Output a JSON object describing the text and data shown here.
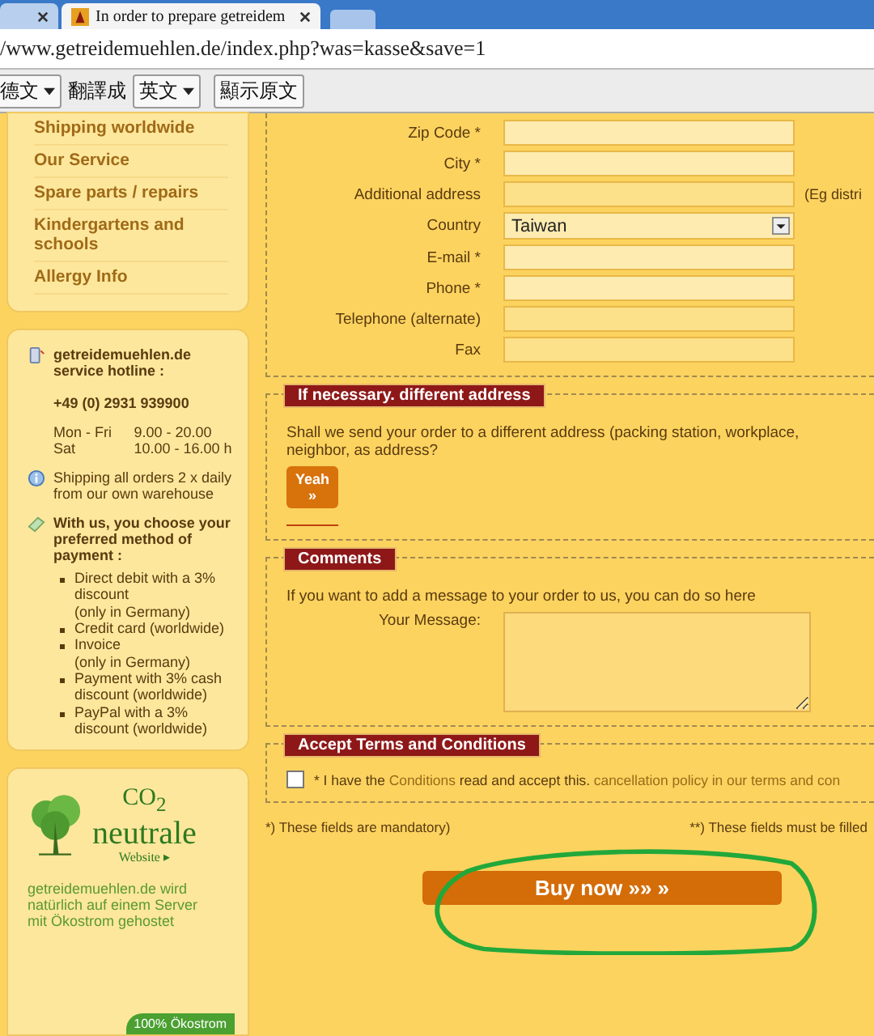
{
  "browser": {
    "tabs": [
      {
        "selected": false
      },
      {
        "title": "In order to prepare getreidem",
        "selected": true
      }
    ],
    "address": "/www.getreidemuehlen.de/index.php?was=kasse&save=1"
  },
  "translate_bar": {
    "from_language": "德文",
    "label": "翻譯成",
    "to_language": "英文",
    "show_original": "顯示原文"
  },
  "sidebar": {
    "nav_items": [
      "Shipping worldwide",
      "Our Service",
      "Spare parts / repairs",
      "Kindergartens and schools",
      "Allergy Info"
    ],
    "hotline": {
      "title": "getreidemuehlen.de service hotline :",
      "phone": "+49 (0) 2931 939900",
      "hours": [
        {
          "days": "Mon - Fri",
          "time": "9.00 - 20.00"
        },
        {
          "days": "Sat",
          "time": "10.00 - 16.00 h"
        }
      ]
    },
    "shipping_note": "Shipping all orders 2 x daily from our own warehouse",
    "payment": {
      "title": "With us, you choose your preferred method of payment :",
      "methods": [
        "Direct debit with a 3% discount\n(only in Germany)",
        "Credit card (worldwide)",
        "Invoice\n(only in Germany)",
        "Payment with 3% cash discount (worldwide)",
        "PayPal with a 3% discount (worldwide)"
      ]
    },
    "eco": {
      "logo_top": "CO$_{2}$",
      "logo_main": "neutrale",
      "logo_link": "Website ▸",
      "text": "getreidemuehlen.de wird natürlich auf einem Server mit Ökostrom gehostet",
      "badge": "100% Ökostrom"
    }
  },
  "address_form": {
    "fields": [
      {
        "label": "Zip Code *",
        "kind": "text"
      },
      {
        "label": "City *",
        "kind": "text"
      },
      {
        "label": "Additional address",
        "kind": "text",
        "hint": "(Eg distri"
      },
      {
        "label": "Country",
        "kind": "select",
        "value": "Taiwan"
      },
      {
        "label": "E-mail *",
        "kind": "text"
      },
      {
        "label": "Phone *",
        "kind": "text"
      },
      {
        "label": "Telephone (alternate)",
        "kind": "text"
      },
      {
        "label": "Fax",
        "kind": "text"
      }
    ]
  },
  "different_address": {
    "legend": "If necessary. different address",
    "question": "Shall we send your order to a different address (packing station, workplace, neighbor, as address?",
    "button": "Yeah\n»"
  },
  "comments": {
    "legend": "Comments",
    "intro": "If you want to add a message to your order to us, you can do so here",
    "message_label": "Your Message:"
  },
  "terms": {
    "legend": "Accept Terms and Conditions",
    "checked": false,
    "before": "* I have the",
    "link": "Conditions",
    "middle": "read and accept this.",
    "link_2": "cancellation policy in our terms and con"
  },
  "footnotes": [
    "*) These fields are mandatory)",
    "**) These fields must be filled"
  ],
  "buy_button": "Buy now »» »"
}
